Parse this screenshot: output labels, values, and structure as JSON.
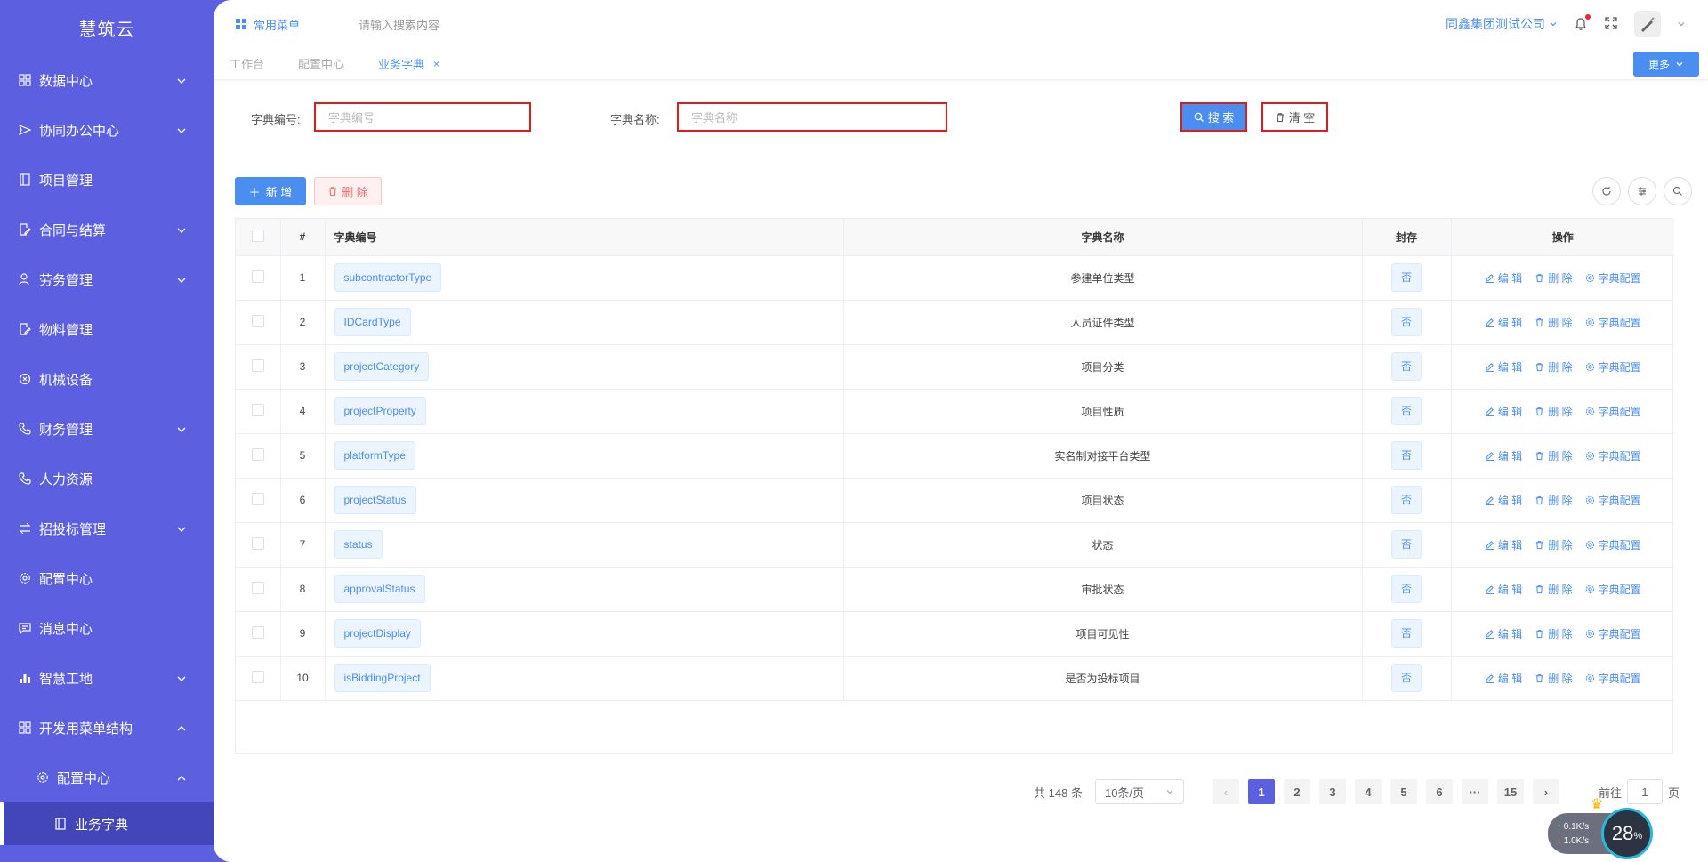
{
  "sidebar": {
    "brand": "慧筑云",
    "items": [
      {
        "label": "数据中心",
        "icon": "grid-icon",
        "expandable": true
      },
      {
        "label": "协同办公中心",
        "icon": "send-icon",
        "expandable": true
      },
      {
        "label": "项目管理",
        "icon": "book-icon",
        "expandable": false
      },
      {
        "label": "合同与结算",
        "icon": "edit-doc-icon",
        "expandable": true
      },
      {
        "label": "劳务管理",
        "icon": "worker-icon",
        "expandable": true
      },
      {
        "label": "物料管理",
        "icon": "edit-doc-icon",
        "expandable": false
      },
      {
        "label": "机械设备",
        "icon": "circle-x-icon",
        "expandable": false
      },
      {
        "label": "财务管理",
        "icon": "phone-icon",
        "expandable": true
      },
      {
        "label": "人力资源",
        "icon": "phone-icon",
        "expandable": false
      },
      {
        "label": "招投标管理",
        "icon": "transfer-icon",
        "expandable": true
      },
      {
        "label": "配置中心",
        "icon": "gear-icon",
        "expandable": false
      },
      {
        "label": "消息中心",
        "icon": "message-icon",
        "expandable": false
      },
      {
        "label": "智慧工地",
        "icon": "bar-chart-icon",
        "expandable": true
      },
      {
        "label": "开发用菜单结构",
        "icon": "grid-icon",
        "expandable": true
      }
    ],
    "sub_item": "配置中心",
    "sub_sub_item": "业务字典"
  },
  "topbar": {
    "common_menu": "常用菜单",
    "search_placeholder": "请输入搜索内容",
    "company": "同鑫集团测试公司"
  },
  "tabs": [
    {
      "label": "工作台"
    },
    {
      "label": "配置中心"
    },
    {
      "label": "业务字典"
    }
  ],
  "more_label": "更多",
  "filter": {
    "code_label": "字典编号:",
    "code_placeholder": "字典编号",
    "name_label": "字典名称:",
    "name_placeholder": "字典名称",
    "search_label": "搜 索",
    "clear_label": "清 空"
  },
  "toolbar": {
    "add_label": "新 增",
    "delete_label": "删 除"
  },
  "table": {
    "headers": [
      "#",
      "字典编号",
      "字典名称",
      "封存",
      "操作"
    ],
    "rows": [
      {
        "idx": "1",
        "code": "subcontractorType",
        "name": "参建单位类型",
        "sealed": "否"
      },
      {
        "idx": "2",
        "code": "IDCardType",
        "name": "人员证件类型",
        "sealed": "否"
      },
      {
        "idx": "3",
        "code": "projectCategory",
        "name": "项目分类",
        "sealed": "否"
      },
      {
        "idx": "4",
        "code": "projectProperty",
        "name": "项目性质",
        "sealed": "否"
      },
      {
        "idx": "5",
        "code": "platformType",
        "name": "实名制对接平台类型",
        "sealed": "否"
      },
      {
        "idx": "6",
        "code": "projectStatus",
        "name": "项目状态",
        "sealed": "否"
      },
      {
        "idx": "7",
        "code": "status",
        "name": "状态",
        "sealed": "否"
      },
      {
        "idx": "8",
        "code": "approvalStatus",
        "name": "审批状态",
        "sealed": "否"
      },
      {
        "idx": "9",
        "code": "projectDisplay",
        "name": "项目可见性",
        "sealed": "否"
      },
      {
        "idx": "10",
        "code": "isBiddingProject",
        "name": "是否为投标项目",
        "sealed": "否"
      }
    ],
    "ops": {
      "edit": "编 辑",
      "delete": "删 除",
      "config": "字典配置"
    }
  },
  "pagination": {
    "total": "共 148 条",
    "page_size": "10条/页",
    "pages": [
      "1",
      "2",
      "3",
      "4",
      "5",
      "6",
      "···",
      "15"
    ],
    "goto_label": "前往",
    "goto_value": "1",
    "page_unit": "页"
  },
  "net_widget": {
    "up": "0.1K/s",
    "down": "1.0K/s",
    "percent": "28",
    "percent_unit": "%"
  },
  "colors": {
    "sidebar": "#5b5fe0",
    "primary": "#4a8ef0",
    "highlight_border": "#e01b1b"
  }
}
